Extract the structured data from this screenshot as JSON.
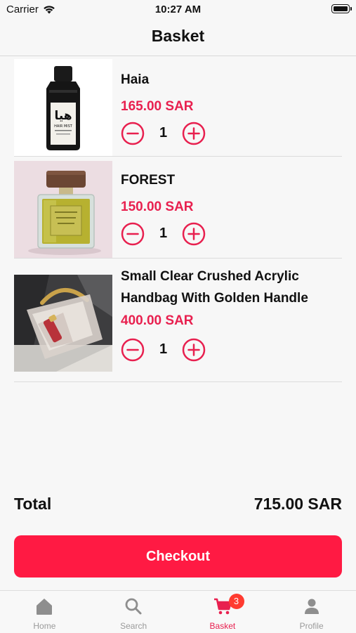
{
  "status_bar": {
    "carrier": "Carrier",
    "time": "10:27 AM"
  },
  "nav": {
    "title": "Basket"
  },
  "items": [
    {
      "name": "Haia",
      "price": "165.00 SAR",
      "quantity": "1",
      "bottle_label": "هيا",
      "bottle_sublabel": "HAIR MIST"
    },
    {
      "name": "FOREST",
      "price": "150.00 SAR",
      "quantity": "1"
    },
    {
      "name": "Small Clear Crushed Acrylic Handbag With Golden Handle",
      "price": "400.00 SAR",
      "quantity": "1"
    }
  ],
  "summary": {
    "total_label": "Total",
    "total_value": "715.00 SAR"
  },
  "checkout": {
    "label": "Checkout"
  },
  "tab_bar": {
    "tabs": [
      {
        "label": "Home",
        "icon": "home-icon"
      },
      {
        "label": "Search",
        "icon": "search-icon"
      },
      {
        "label": "Basket",
        "icon": "cart-icon",
        "badge": "3",
        "active": true
      },
      {
        "label": "Profile",
        "icon": "person-icon"
      }
    ]
  },
  "colors": {
    "accent": "#e8204f",
    "checkout": "#ff1a43",
    "badge": "#ff3b30",
    "inactive_tab": "#9a9a9a"
  }
}
